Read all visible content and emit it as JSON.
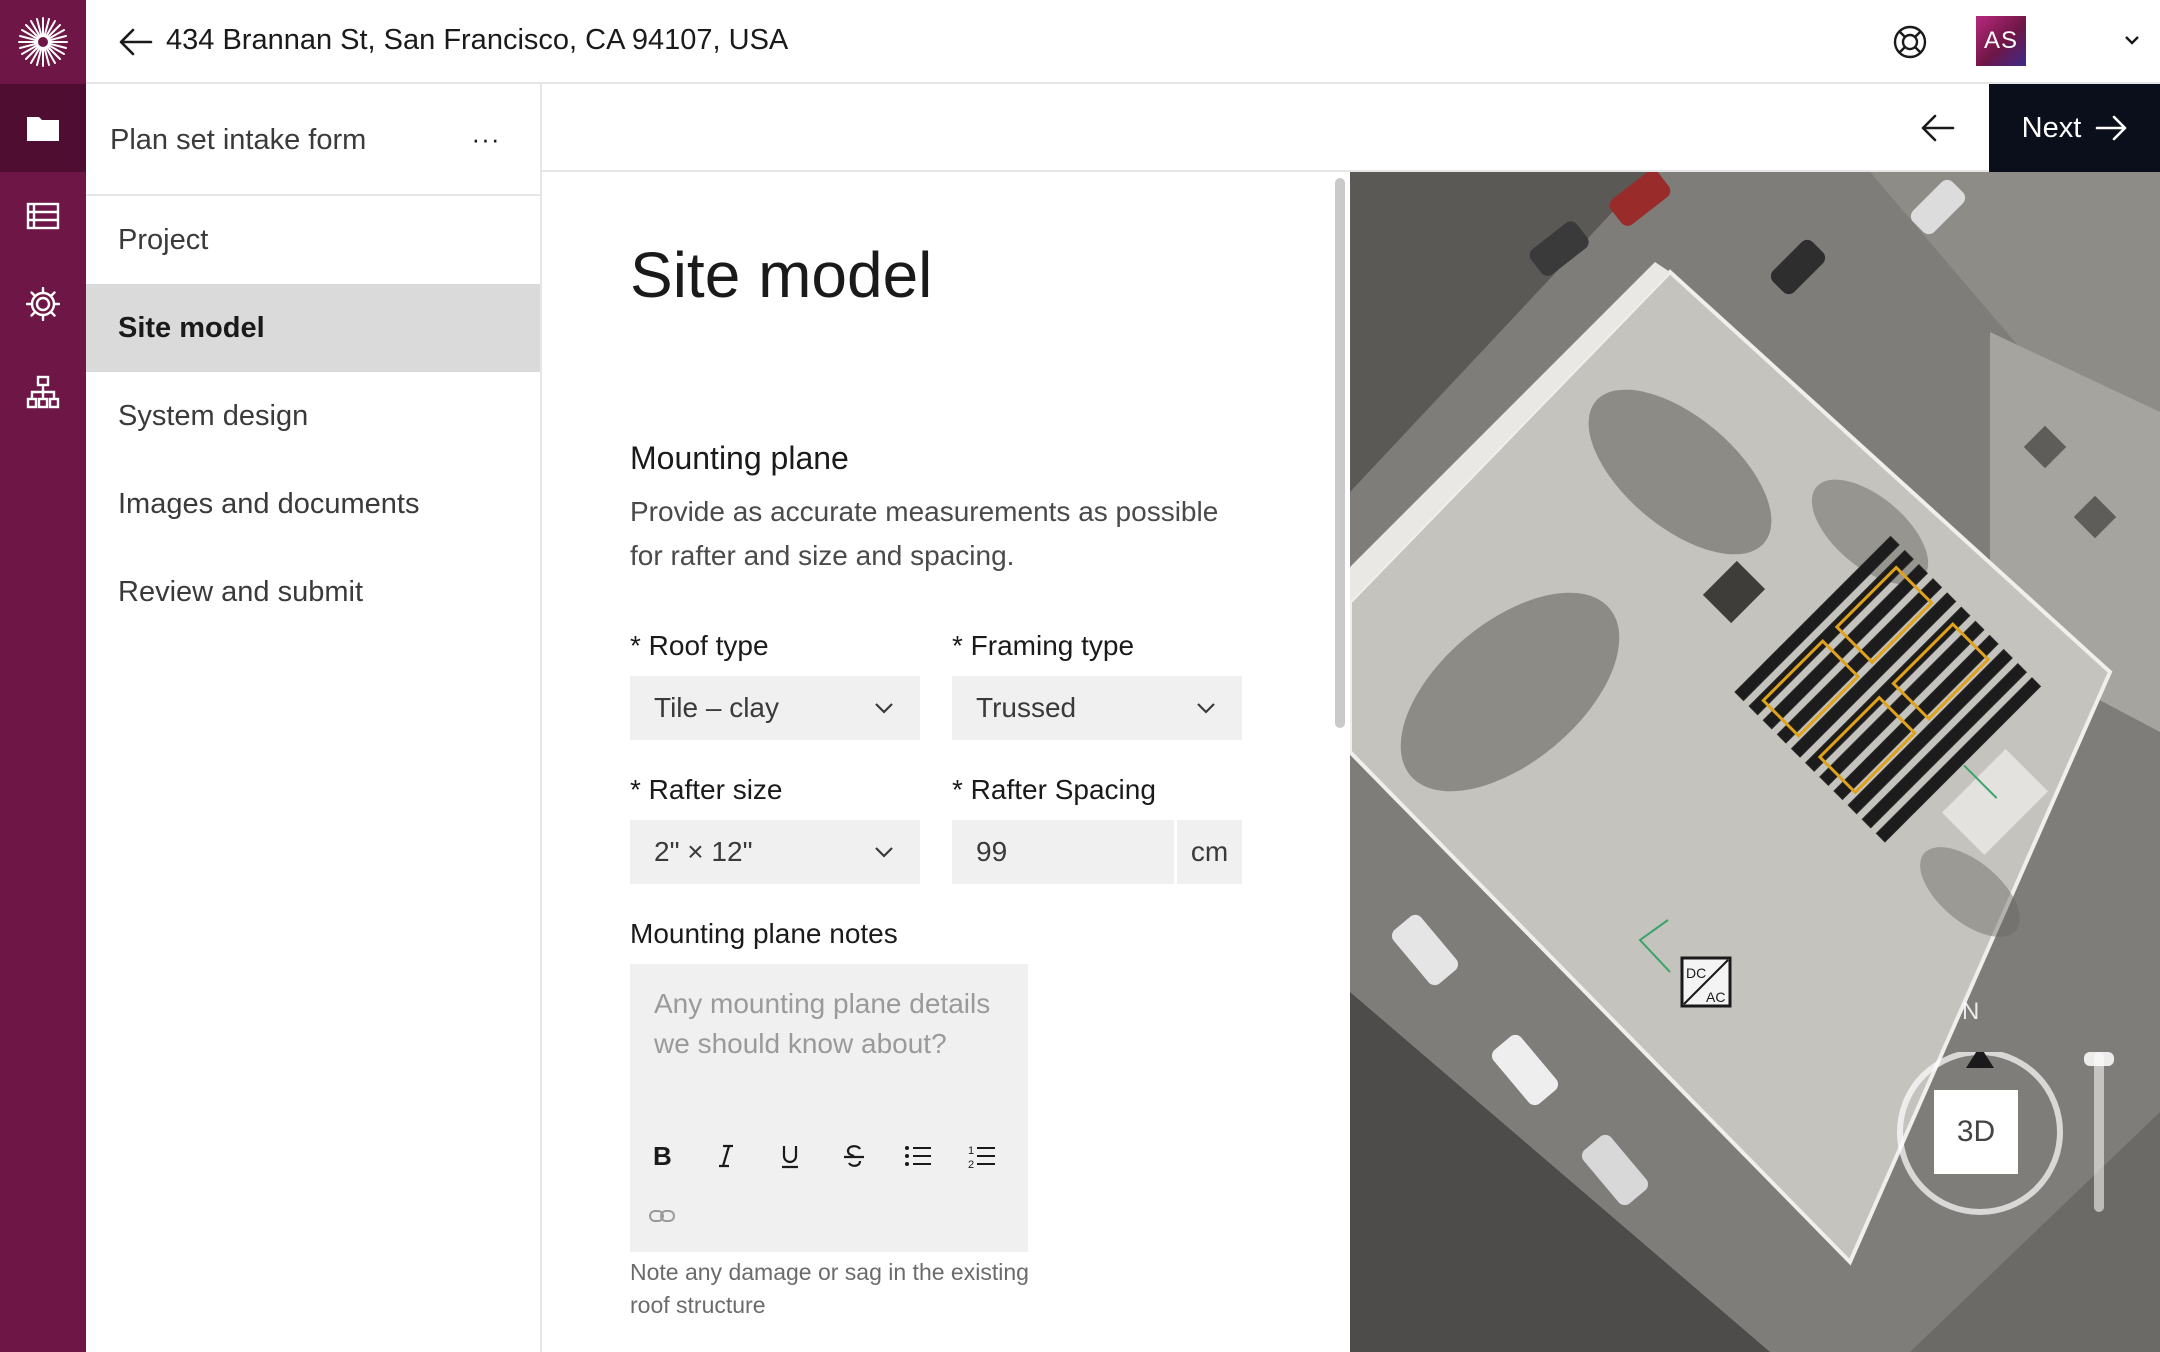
{
  "header": {
    "address": "434 Brannan St, San Francisco, CA 94107, USA",
    "avatar_initials": "AS",
    "icons": [
      "back-arrow-icon",
      "help-icon",
      "bell-icon",
      "chevron-down-icon"
    ]
  },
  "rail": {
    "brand_color": "#6e1646",
    "items": [
      "folder-icon",
      "list-icon",
      "gear-icon",
      "sitemap-icon"
    ],
    "active": "folder-icon"
  },
  "nav": {
    "title": "Plan set intake form",
    "more": "···",
    "items": [
      {
        "label": "Project"
      },
      {
        "label": "Site model"
      },
      {
        "label": "System design"
      },
      {
        "label": "Images and documents"
      },
      {
        "label": "Review and submit"
      }
    ],
    "active_index": 1
  },
  "toolbar": {
    "next_label": "Next"
  },
  "form": {
    "title": "Site model",
    "section_title": "Mounting plane",
    "section_desc": "Provide as accurate measurements as possible for rafter and size and spacing.",
    "roof_type": {
      "label": "* Roof type",
      "value": "Tile – clay"
    },
    "framing_type": {
      "label": "* Framing type",
      "value": "Trussed"
    },
    "rafter_size": {
      "label": "* Rafter size",
      "value": "2\" × 12\""
    },
    "rafter_spacing": {
      "label": "* Rafter Spacing",
      "value": "99",
      "unit": "cm"
    },
    "notes": {
      "label": "Mounting plane notes",
      "placeholder": "Any mounting plane details we should know about?",
      "help": "Note any damage or sag in the existing roof structure",
      "tools": [
        "bold-icon",
        "italic-icon",
        "underline-icon",
        "strikethrough-icon",
        "bullet-list-icon",
        "numbered-list-icon",
        "link-icon"
      ]
    }
  },
  "map": {
    "compass_label": "N",
    "view_button": "3D",
    "equipment_label_top": "DC",
    "equipment_label_bottom": "AC",
    "panel_color": "#1c1c1c",
    "string_color": "#e0a21a"
  }
}
